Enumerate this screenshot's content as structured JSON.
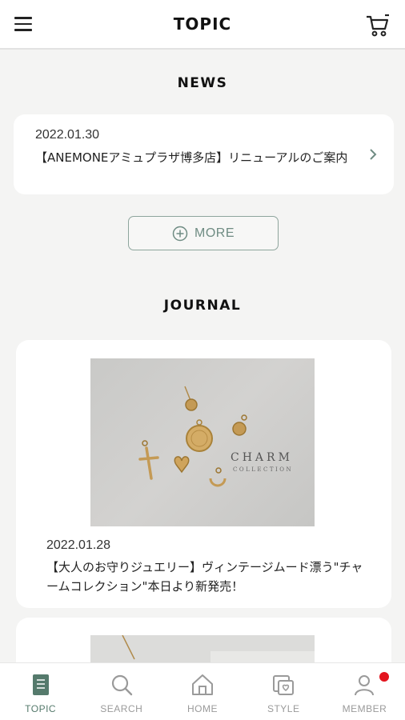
{
  "header": {
    "title": "TOPIC"
  },
  "news": {
    "section_title": "NEWS",
    "items": [
      {
        "date": "2022.01.30",
        "text": "【ANEMONEアミュプラザ博多店】リニューアルのご案内"
      }
    ],
    "more_label": "MORE"
  },
  "journal": {
    "section_title": "JOURNAL",
    "items": [
      {
        "date": "2022.01.28",
        "text": "【大人のお守りジュエリー】ヴィンテージムード漂う\"チャームコレクション\"本日より新発売！",
        "image_caption_main": "CHARM",
        "image_caption_sub": "COLLECTION"
      }
    ]
  },
  "tabbar": {
    "tabs": [
      {
        "label": "TOPIC",
        "icon": "topic-icon",
        "active": true
      },
      {
        "label": "SEARCH",
        "icon": "search-icon"
      },
      {
        "label": "HOME",
        "icon": "home-icon"
      },
      {
        "label": "STYLE",
        "icon": "style-icon"
      },
      {
        "label": "MEMBER",
        "icon": "member-icon",
        "badge": true
      }
    ]
  },
  "colors": {
    "accent": "#557a6c",
    "background": "#f4f4f3",
    "badge": "#e3141e"
  }
}
